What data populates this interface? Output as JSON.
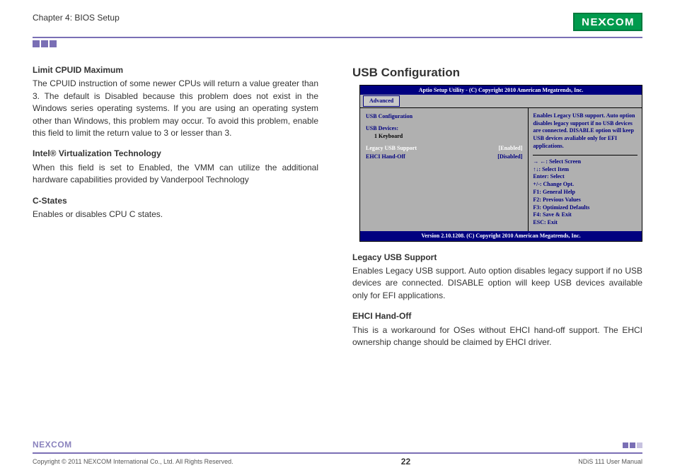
{
  "chapter": "Chapter 4: BIOS Setup",
  "logo": "NEXCOM",
  "left": {
    "h1": {
      "title": "Limit CPUID Maximum",
      "body": "The CPUID instruction of some newer CPUs will return a value greater than 3. The default is Disabled because this problem does not exist in the Windows series operating systems. If you are using an operating system other than Windows, this problem may occur. To avoid this problem, enable this field to limit the return value to 3 or lesser than 3."
    },
    "h2": {
      "title": "Intel® Virtualization Technology",
      "body": "When this field is set to Enabled, the VMM can utilize the additional hardware capabilities provided by Vanderpool Technology"
    },
    "h3": {
      "title": "C-States",
      "body": "Enables or disables CPU C states."
    }
  },
  "right": {
    "title": "USB Configuration",
    "legacy": {
      "title": "Legacy USB Support",
      "body": "Enables Legacy USB support. Auto option disables legacy support if no USB devices are connected. DISABLE option will keep USB devices available only for EFI applications."
    },
    "ehci": {
      "title": "EHCI Hand-Off",
      "body": "This is a workaround for OSes without EHCI hand-off support. The EHCI ownership change should be claimed by EHCI driver."
    }
  },
  "bios": {
    "top": "Aptio Setup Utility - (C) Copyright 2010 American Megatrends, Inc.",
    "tab": "Advanced",
    "section": "USB Configuration",
    "devlabel": "USB Devices:",
    "devval": "1 Keyboard",
    "r1": {
      "label": "Legacy USB Support",
      "val": "[Enabled]"
    },
    "r2": {
      "label": "EHCI Hand-Off",
      "val": "[Disabled]"
    },
    "help": "Enables Legacy USB support. Auto option disables legacy support if no USB devices are connected. DISABLE option will keep USB devices avaliable only for EFI applications.",
    "k1": "→ ←: Select Screen",
    "k2": "↑↓: Select Item",
    "k3": "Enter: Select",
    "k4": "+/-: Change Opt.",
    "k5": "F1: General Help",
    "k6": "F2: Previous Values",
    "k7": "F3: Optimized Defaults",
    "k8": "F4: Save & Exit",
    "k9": "ESC: Exit",
    "bottom": "Version 2.10.1208. (C) Copyright 2010 American Megatrends, Inc."
  },
  "footer": {
    "copyright": "Copyright © 2011 NEXCOM International Co., Ltd. All Rights Reserved.",
    "page": "22",
    "doc": "NDiS 111 User Manual",
    "logo": "NEXCOM"
  }
}
